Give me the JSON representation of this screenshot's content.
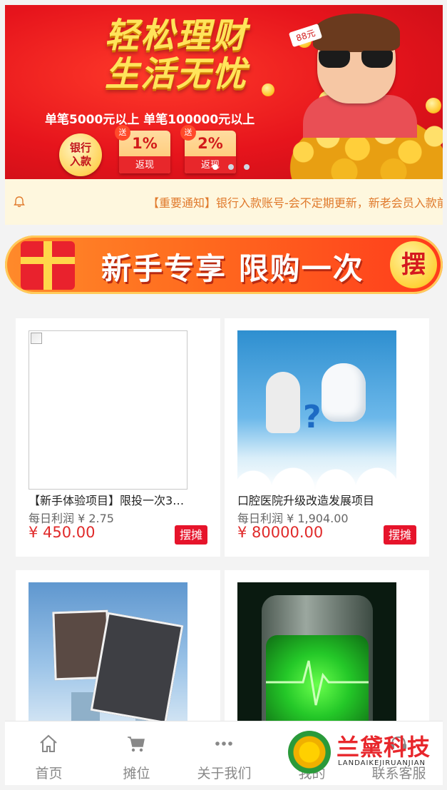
{
  "banner": {
    "title_line1": "轻松理财",
    "title_line2": "生活无忧",
    "subtitle": "单笔5000元以上 单笔100000元以上",
    "bank_badge": "银行入款",
    "bonus1": {
      "tag": "送",
      "percent": "1%",
      "label": "返现"
    },
    "bonus2": {
      "tag": "送",
      "percent": "2%",
      "label": "返现"
    },
    "envelope_tag": "88元",
    "slide_count": 3,
    "active_slide": 1
  },
  "notice": {
    "icon": "bell-icon",
    "text": "【重要通知】银行入款账号-会不定期更新，新老会员入款前请先核对账号"
  },
  "promo": {
    "text": "新手专享 限购一次",
    "seal": "摆"
  },
  "products": [
    {
      "name": "【新手体验项目】限投一次3…",
      "profit_label": "每日利润 ¥ 2.75",
      "price": "¥ 450.00",
      "button": "摆摊",
      "image": "broken"
    },
    {
      "name": "口腔医院升级改造发展项目",
      "profit_label": "每日利润 ¥ 1,904.00",
      "price": "¥ 80000.00",
      "button": "摆摊",
      "image": "teeth"
    },
    {
      "name": "",
      "profit_label": "",
      "price": "",
      "button": "",
      "image": "building"
    },
    {
      "name": "",
      "profit_label": "",
      "price": "",
      "button": "",
      "image": "battery"
    }
  ],
  "tabbar": {
    "items": [
      {
        "label": "首页",
        "icon": "home-icon"
      },
      {
        "label": "摊位",
        "icon": "cart-icon"
      },
      {
        "label": "关于我们",
        "icon": "more-icon"
      },
      {
        "label": "我的",
        "icon": "user-icon"
      },
      {
        "label": "联系客服",
        "icon": "service-icon"
      }
    ]
  },
  "watermark": {
    "cn": "兰黛科技",
    "en": "LANDAIKEJIRUANJIAN"
  },
  "colors": {
    "price_red": "#e02a2a",
    "button_red": "#e6142b",
    "notice_bg": "#fef7de",
    "notice_text": "#e07a2c"
  }
}
